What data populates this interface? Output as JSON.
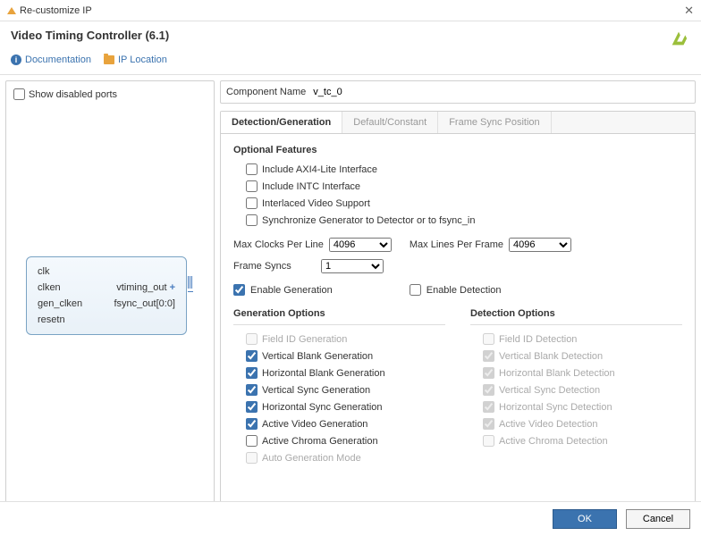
{
  "window": {
    "title": "Re-customize IP"
  },
  "header": {
    "title": "Video Timing Controller (6.1)"
  },
  "toolbar": {
    "doc": "Documentation",
    "loc": "IP Location"
  },
  "left": {
    "show_disabled": "Show disabled ports"
  },
  "ip_block": {
    "in": [
      "clk",
      "clken",
      "gen_clken",
      "resetn"
    ],
    "out": [
      "vtiming_out",
      "fsync_out[0:0]"
    ]
  },
  "comp": {
    "label": "Component Name",
    "value": "v_tc_0"
  },
  "tabs": {
    "t0": "Detection/Generation",
    "t1": "Default/Constant",
    "t2": "Frame Sync Position"
  },
  "opt": {
    "title": "Optional Features",
    "axi": "Include AXI4-Lite Interface",
    "intc": "Include INTC Interface",
    "interlaced": "Interlaced Video Support",
    "sync": "Synchronize Generator to Detector or to fsync_in"
  },
  "sel": {
    "mcpl": "Max Clocks Per Line",
    "mcpl_v": "4096",
    "mlpf": "Max Lines Per Frame",
    "mlpf_v": "4096",
    "fs": "Frame Syncs",
    "fs_v": "1",
    "eg": "Enable Generation",
    "ed": "Enable Detection"
  },
  "gen": {
    "title": "Generation Options",
    "field": "Field ID Generation",
    "vb": "Vertical Blank Generation",
    "hb": "Horizontal Blank Generation",
    "vs": "Vertical Sync Generation",
    "hs": "Horizontal Sync Generation",
    "av": "Active Video Generation",
    "ac": "Active Chroma Generation",
    "auto": "Auto Generation Mode"
  },
  "det": {
    "title": "Detection Options",
    "field": "Field ID Detection",
    "vb": "Vertical Blank Detection",
    "hb": "Horizontal Blank Detection",
    "vs": "Vertical Sync Detection",
    "hs": "Horizontal Sync Detection",
    "av": "Active Video Detection",
    "ac": "Active Chroma Detection"
  },
  "footer": {
    "ok": "OK",
    "cancel": "Cancel"
  }
}
